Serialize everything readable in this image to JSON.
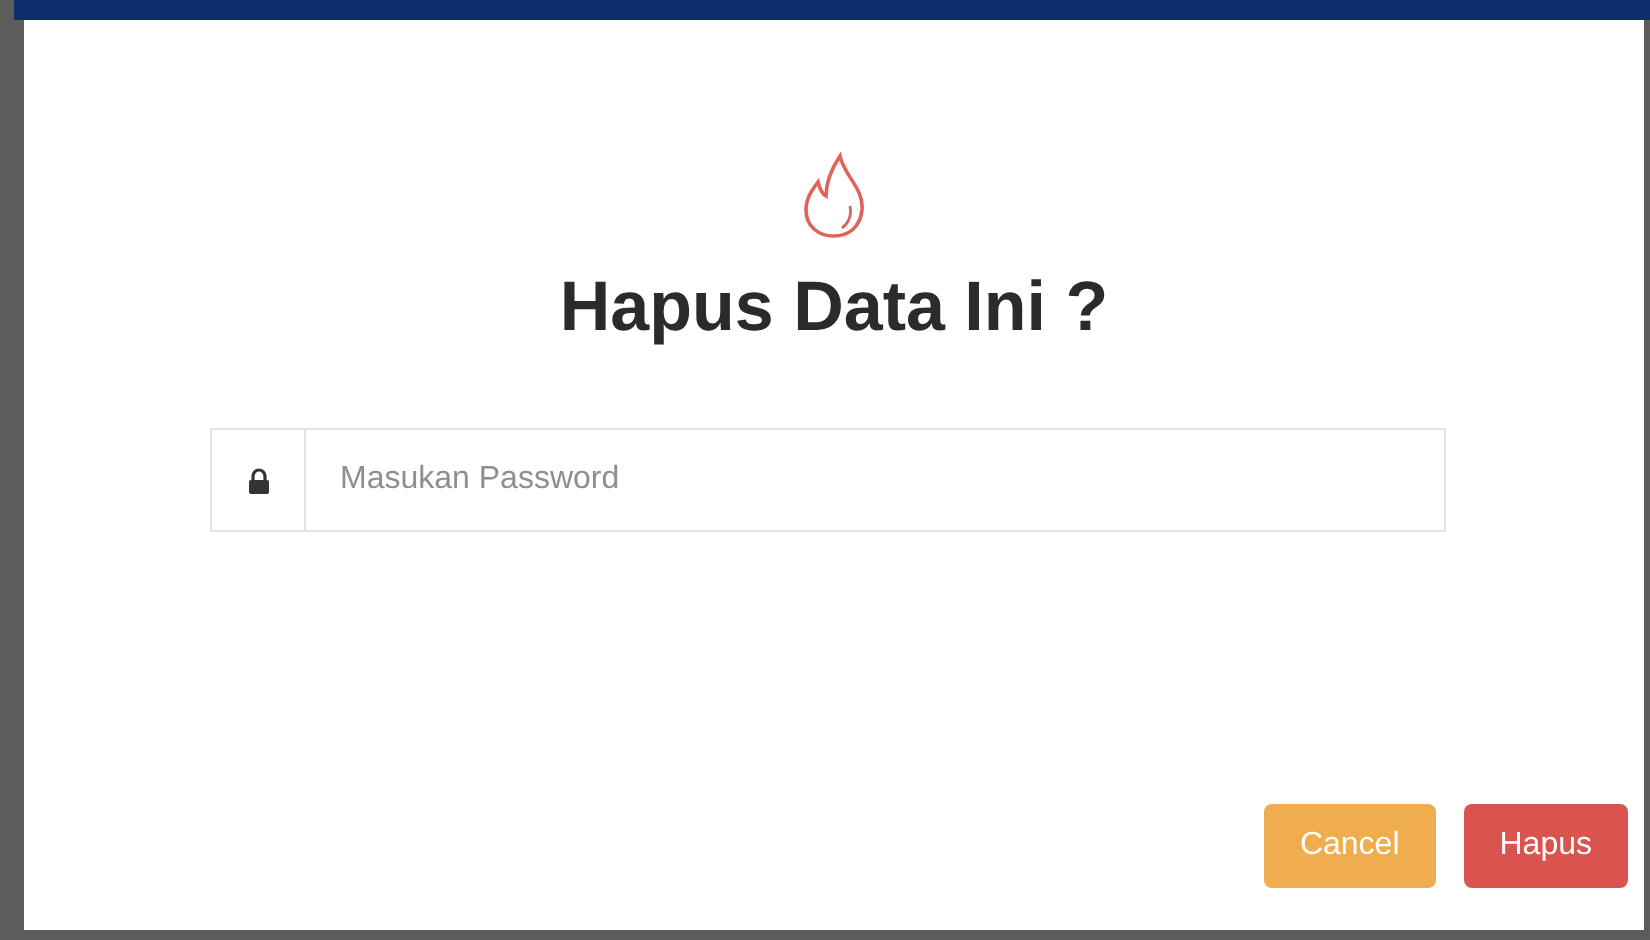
{
  "dialog": {
    "title": "Hapus Data Ini ?",
    "password_field": {
      "placeholder": "Masukan Password"
    },
    "buttons": [
      {
        "label": "Cancel",
        "kind": "cancel"
      },
      {
        "label": "Hapus",
        "kind": "danger"
      }
    ]
  }
}
